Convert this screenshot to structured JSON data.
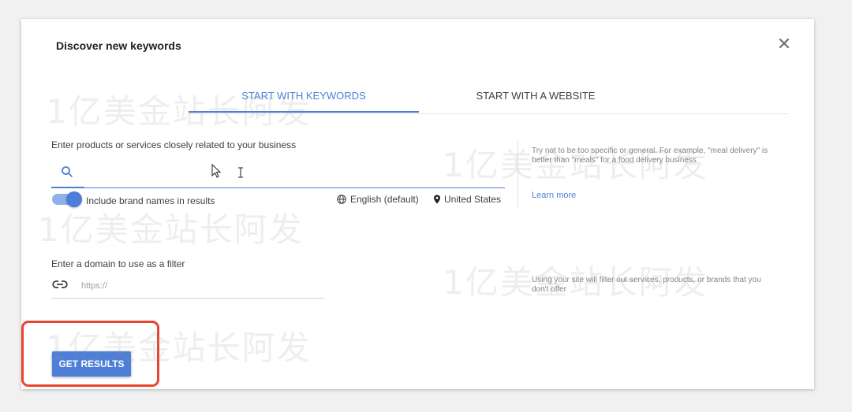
{
  "dialog": {
    "title": "Discover new keywords",
    "close_glyph": "✕"
  },
  "tabs": [
    {
      "label": "START WITH KEYWORDS",
      "active": true
    },
    {
      "label": "START WITH A WEBSITE",
      "active": false
    }
  ],
  "keywords": {
    "label": "Enter products or services closely related to your business",
    "icon": "search-icon",
    "hint": "Try not to be too specific or general. For example, \"meal delivery\" is better than \"meals\" for a food delivery business",
    "learn_more": "Learn more"
  },
  "brand_toggle": {
    "label": "Include brand names in results",
    "on": true
  },
  "language": "English (default)",
  "location": "United States",
  "domain": {
    "label": "Enter a domain to use as a filter",
    "placeholder": "https://",
    "hint": "Using your site will filter out services, products, or brands that you don't offer"
  },
  "button": {
    "label": "GET RESULTS"
  },
  "watermark": "1亿美金站长阿发",
  "colors": {
    "accent": "#4d7fd8",
    "highlight": "#e8442e"
  }
}
